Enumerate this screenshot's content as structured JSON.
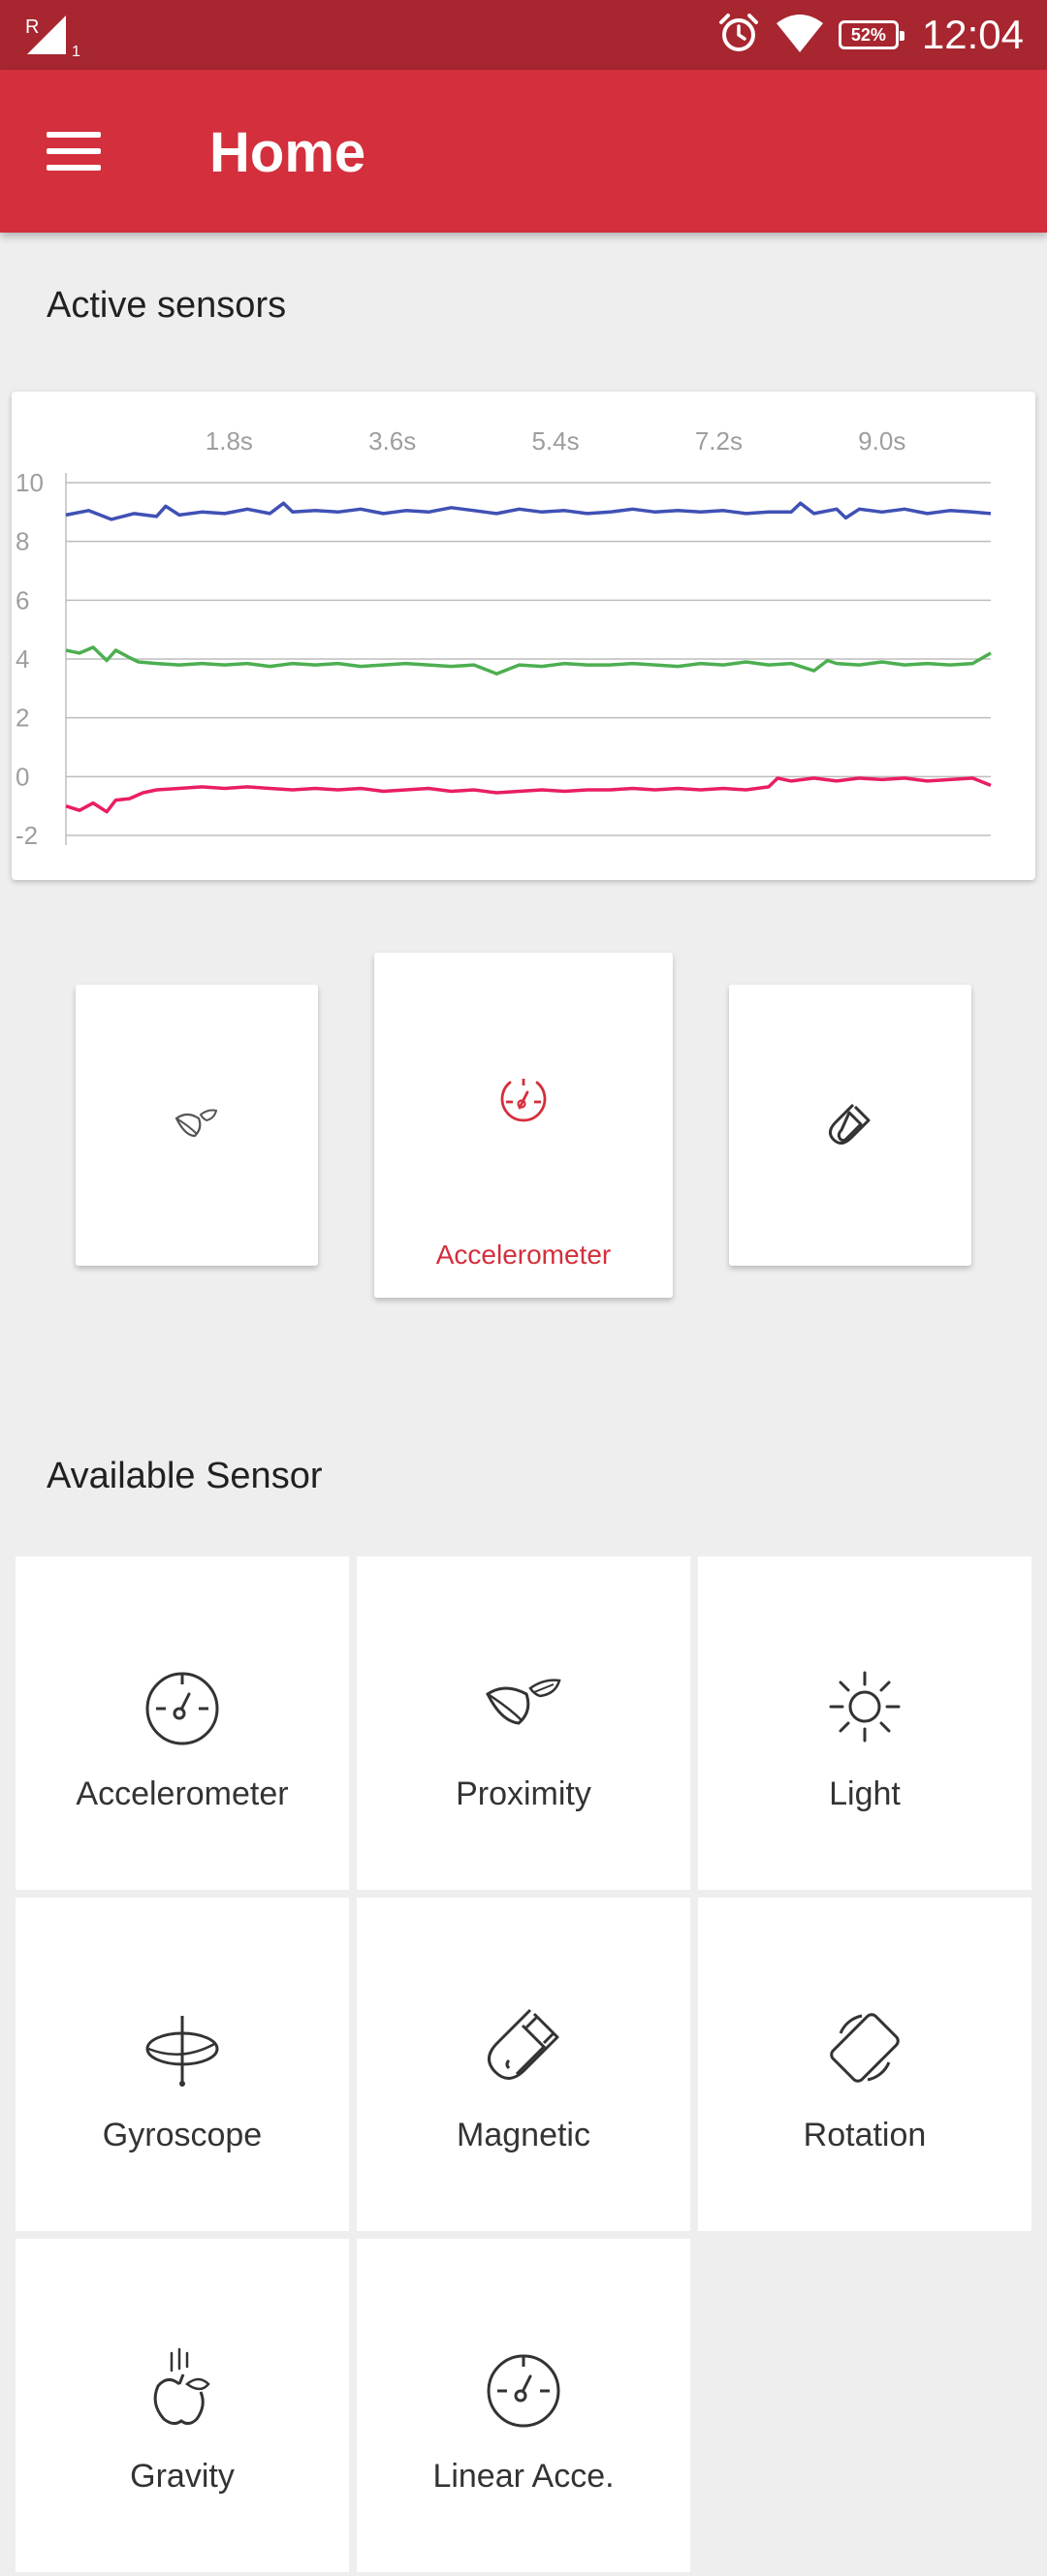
{
  "status_bar": {
    "network_label": "R",
    "sim_label": "1",
    "battery": "52%",
    "time": "12:04"
  },
  "app_bar": {
    "title": "Home",
    "menu_icon": "hamburger-menu-icon"
  },
  "active_section": {
    "title": "Active sensors"
  },
  "chart_data": {
    "type": "line",
    "x_ticks": [
      "1.8s",
      "3.6s",
      "5.4s",
      "7.2s",
      "9.0s"
    ],
    "y_ticks": [
      "10",
      "8",
      "6",
      "4",
      "2",
      "0",
      "-2"
    ],
    "ylim": [
      -2,
      10
    ],
    "xlim": [
      0,
      10.2
    ],
    "grid": true,
    "series": [
      {
        "color": "#3f51b5",
        "x": [
          0,
          0.25,
          0.5,
          0.75,
          1.0,
          1.1,
          1.25,
          1.5,
          1.75,
          2.0,
          2.25,
          2.4,
          2.5,
          2.75,
          3.0,
          3.25,
          3.5,
          3.75,
          4.0,
          4.25,
          4.5,
          4.75,
          5.0,
          5.25,
          5.5,
          5.75,
          6.0,
          6.25,
          6.5,
          6.75,
          7.0,
          7.25,
          7.5,
          7.75,
          8.0,
          8.1,
          8.25,
          8.5,
          8.6,
          8.75,
          9.0,
          9.25,
          9.5,
          9.75,
          10.0,
          10.2
        ],
        "y": [
          8.9,
          9.05,
          8.75,
          8.95,
          8.85,
          9.2,
          8.9,
          9.0,
          8.95,
          9.1,
          8.95,
          9.3,
          9.0,
          9.05,
          9.0,
          9.1,
          8.95,
          9.05,
          9.0,
          9.15,
          9.05,
          8.95,
          9.1,
          9.0,
          9.05,
          8.95,
          9.0,
          9.1,
          9.0,
          9.05,
          9.0,
          9.05,
          8.95,
          9.0,
          9.0,
          9.3,
          8.95,
          9.1,
          8.8,
          9.1,
          9.0,
          9.1,
          8.95,
          9.05,
          9.0,
          8.95
        ]
      },
      {
        "color": "#4caf50",
        "x": [
          0,
          0.15,
          0.3,
          0.45,
          0.55,
          0.7,
          0.8,
          1.0,
          1.25,
          1.5,
          1.75,
          2.0,
          2.25,
          2.5,
          2.75,
          3.0,
          3.25,
          3.5,
          3.75,
          4.0,
          4.25,
          4.5,
          4.75,
          5.0,
          5.25,
          5.5,
          5.75,
          6.0,
          6.25,
          6.5,
          6.75,
          7.0,
          7.25,
          7.5,
          7.75,
          8.0,
          8.25,
          8.4,
          8.5,
          8.75,
          9.0,
          9.25,
          9.5,
          9.75,
          10.0,
          10.2
        ],
        "y": [
          4.3,
          4.2,
          4.4,
          3.95,
          4.3,
          4.05,
          3.9,
          3.85,
          3.8,
          3.85,
          3.8,
          3.85,
          3.75,
          3.85,
          3.8,
          3.85,
          3.75,
          3.8,
          3.85,
          3.8,
          3.75,
          3.8,
          3.5,
          3.8,
          3.75,
          3.85,
          3.8,
          3.8,
          3.85,
          3.8,
          3.75,
          3.85,
          3.8,
          3.9,
          3.8,
          3.85,
          3.6,
          3.95,
          3.85,
          3.8,
          3.9,
          3.8,
          3.85,
          3.8,
          3.85,
          4.2
        ]
      },
      {
        "color": "#e91e63",
        "x": [
          0,
          0.15,
          0.3,
          0.45,
          0.55,
          0.7,
          0.85,
          1.0,
          1.25,
          1.5,
          1.75,
          2.0,
          2.25,
          2.5,
          2.75,
          3.0,
          3.25,
          3.5,
          3.75,
          4.0,
          4.25,
          4.5,
          4.75,
          5.0,
          5.25,
          5.5,
          5.75,
          6.0,
          6.25,
          6.5,
          6.75,
          7.0,
          7.25,
          7.5,
          7.75,
          7.85,
          8.0,
          8.25,
          8.5,
          8.75,
          9.0,
          9.25,
          9.5,
          9.75,
          10.0,
          10.2
        ],
        "y": [
          -1.0,
          -1.15,
          -0.9,
          -1.2,
          -0.8,
          -0.75,
          -0.55,
          -0.45,
          -0.4,
          -0.35,
          -0.4,
          -0.35,
          -0.4,
          -0.45,
          -0.4,
          -0.45,
          -0.4,
          -0.5,
          -0.45,
          -0.4,
          -0.5,
          -0.45,
          -0.55,
          -0.5,
          -0.45,
          -0.5,
          -0.45,
          -0.45,
          -0.4,
          -0.45,
          -0.4,
          -0.45,
          -0.4,
          -0.45,
          -0.35,
          -0.05,
          -0.15,
          -0.05,
          -0.15,
          -0.05,
          -0.1,
          -0.05,
          -0.15,
          -0.1,
          -0.05,
          -0.3
        ]
      }
    ]
  },
  "active_cards": [
    {
      "icon": "leaf-icon",
      "label": ""
    },
    {
      "icon": "speedometer-icon",
      "label": "Accelerometer"
    },
    {
      "icon": "magnet-icon",
      "label": ""
    }
  ],
  "available_section": {
    "title": "Available Sensor",
    "items": [
      {
        "label": "Accelerometer",
        "icon": "speedometer-icon"
      },
      {
        "label": "Proximity",
        "icon": "leaf-icon"
      },
      {
        "label": "Light",
        "icon": "sun-icon"
      },
      {
        "label": "Gyroscope",
        "icon": "gyroscope-icon"
      },
      {
        "label": "Magnetic",
        "icon": "magnet-icon"
      },
      {
        "label": "Rotation",
        "icon": "screen-rotation-icon"
      },
      {
        "label": "Gravity",
        "icon": "falling-apple-icon"
      },
      {
        "label": "Linear Acce.",
        "icon": "speedometer-icon"
      }
    ]
  },
  "colors": {
    "status_bar": "#a7262f",
    "app_bar": "#d32f3c",
    "accent": "#d32f3c",
    "background": "#eeeeee"
  }
}
